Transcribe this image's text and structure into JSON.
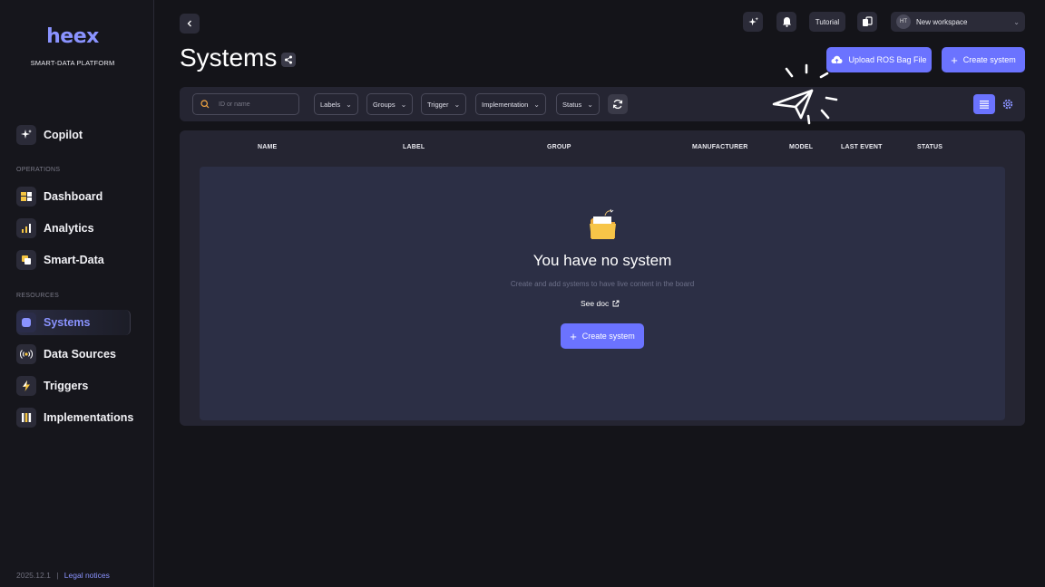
{
  "brand": {
    "name": "heex",
    "tagline": "SMART-DATA PLATFORM"
  },
  "sidebar": {
    "copilot": "Copilot",
    "sections": {
      "operations": "OPERATIONS",
      "resources": "RESOURCES"
    },
    "operations": [
      {
        "label": "Dashboard",
        "icon": "dashboard-icon"
      },
      {
        "label": "Analytics",
        "icon": "analytics-icon"
      },
      {
        "label": "Smart-Data",
        "icon": "smart-data-icon"
      }
    ],
    "resources": [
      {
        "label": "Systems",
        "icon": "systems-icon",
        "active": true
      },
      {
        "label": "Data Sources",
        "icon": "data-sources-icon"
      },
      {
        "label": "Triggers",
        "icon": "triggers-icon"
      },
      {
        "label": "Implementations",
        "icon": "implementations-icon"
      }
    ],
    "footer": {
      "version": "2025.12.1",
      "separator": "|",
      "legal": "Legal notices"
    }
  },
  "header": {
    "tutorial": "Tutorial",
    "workspace": {
      "initials": "HT",
      "name": "New workspace"
    }
  },
  "page": {
    "title": "Systems",
    "upload_button": "Upload ROS Bag File",
    "create_button": "Create system"
  },
  "filters": {
    "search_placeholder": "ID or name",
    "chips": [
      "Labels",
      "Groups",
      "Trigger",
      "Implementation",
      "Status"
    ]
  },
  "table": {
    "columns": [
      "NAME",
      "LABEL",
      "GROUP",
      "MANUFACTURER",
      "MODEL",
      "LAST EVENT",
      "STATUS"
    ],
    "empty": {
      "title": "You have no system",
      "subtitle": "Create and add systems to have live content in the board",
      "doc_link": "See doc",
      "create_button": "Create system"
    }
  },
  "colors": {
    "accent": "#6b73ff",
    "background": "#141419",
    "panel": "#252532"
  }
}
